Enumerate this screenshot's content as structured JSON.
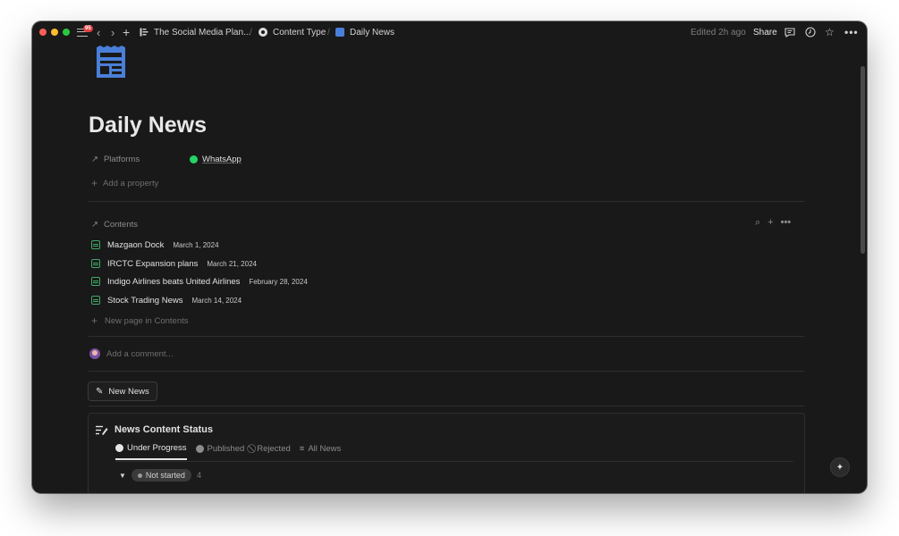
{
  "titlebar": {
    "badge": "95",
    "breadcrumbs": [
      {
        "label": "The Social Media Plan..."
      },
      {
        "label": "Content Type"
      },
      {
        "label": "Daily News"
      }
    ],
    "separator": "/",
    "edited": "Edited 2h ago",
    "share_label": "Share"
  },
  "page": {
    "title": "Daily News",
    "properties": [
      {
        "label": "Platforms",
        "value": "WhatsApp"
      }
    ],
    "add_property": "Add a property"
  },
  "contents": {
    "label": "Contents",
    "rows": [
      {
        "title": "Mazgaon Dock",
        "date": "March 1, 2024"
      },
      {
        "title": "IRCTC Expansion plans",
        "date": "March 21, 2024"
      },
      {
        "title": "Indigo Airlines beats United Airlines",
        "date": "February 28, 2024"
      },
      {
        "title": "Stock Trading News",
        "date": "March 14, 2024"
      }
    ],
    "new_page": "New page in Contents"
  },
  "comment": {
    "placeholder": "Add a comment..."
  },
  "new_button": {
    "label": "New News"
  },
  "database": {
    "title": "News Content Status",
    "tabs": [
      {
        "label": "Under Progress",
        "active": true
      },
      {
        "label": "Published",
        "active": false
      },
      {
        "label": "Rejected",
        "active": false
      },
      {
        "label": "All News",
        "active": false
      }
    ],
    "group": {
      "label": "Not started",
      "count": "4"
    }
  },
  "colors": {
    "background": "#191919",
    "accent_blue": "#4a7fd9",
    "whatsapp_green": "#25d366",
    "page_icon_green": "#3fa86a"
  }
}
